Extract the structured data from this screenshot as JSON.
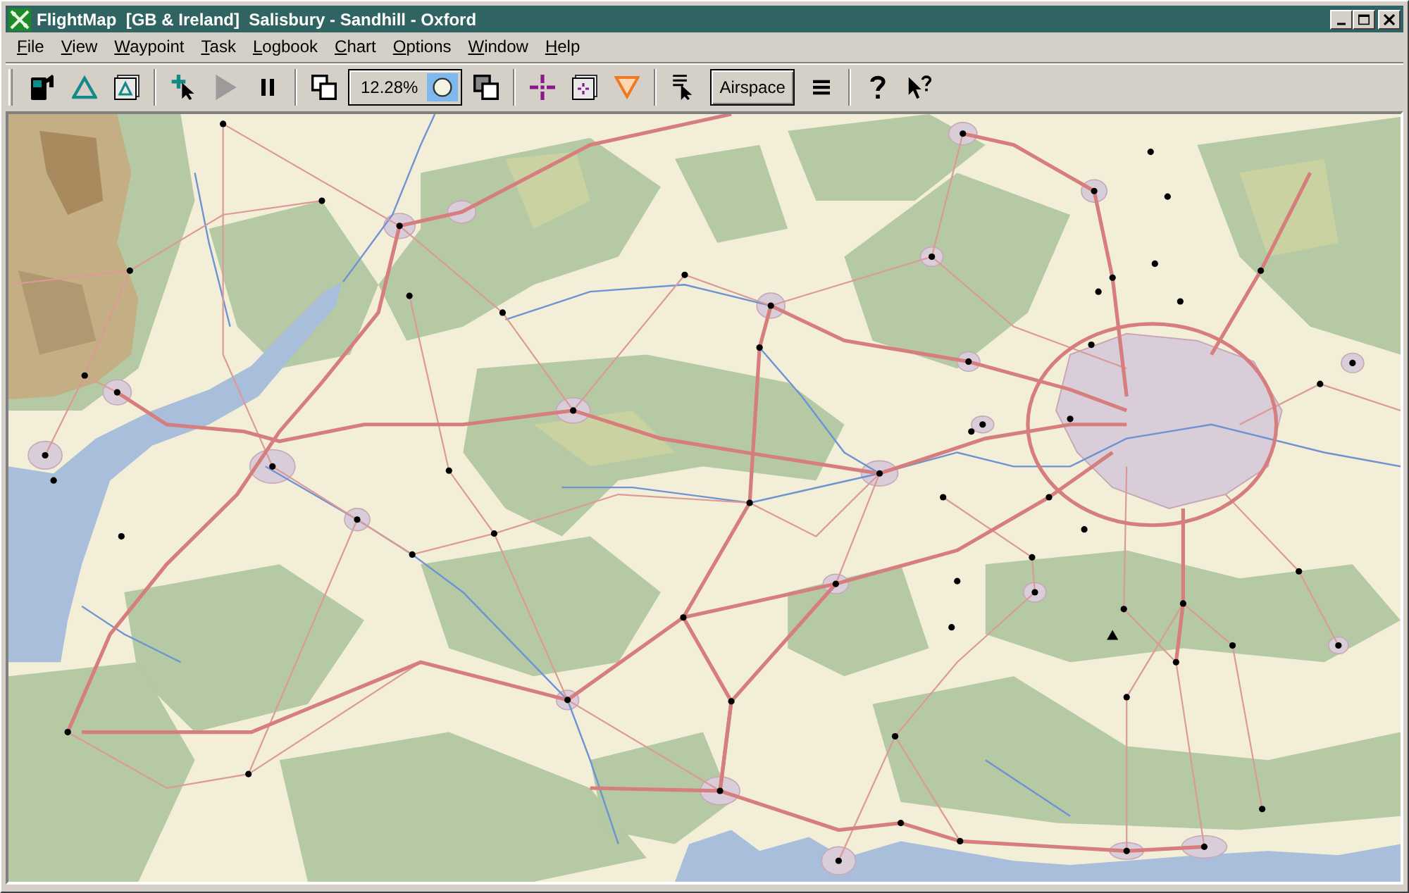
{
  "window": {
    "title": "FlightMap  [GB & Ireland]  Salisbury - Sandhill - Oxford"
  },
  "menu": [
    "File",
    "View",
    "Waypoint",
    "Task",
    "Logbook",
    "Chart",
    "Options",
    "Window",
    "Help"
  ],
  "toolbar": {
    "groups": [
      [
        {
          "kind": "icon",
          "disabled": false
        },
        {
          "kind": "icon",
          "disabled": false
        },
        {
          "kind": "icon",
          "disabled": false
        }
      ],
      [
        {
          "kind": "icon",
          "disabled": false
        },
        {
          "kind": "icon",
          "disabled": true
        },
        {
          "kind": "icon",
          "disabled": false
        }
      ],
      [
        {
          "kind": "icon",
          "disabled": false
        },
        {
          "kind": "zoom",
          "value": "12.28%",
          "pressed": true
        },
        {
          "kind": "icon",
          "disabled": false
        }
      ],
      [
        {
          "kind": "icon",
          "disabled": false
        },
        {
          "kind": "icon",
          "disabled": false
        },
        {
          "kind": "icon",
          "disabled": false
        }
      ],
      [
        {
          "kind": "icon",
          "disabled": false
        },
        {
          "kind": "text",
          "label": "Airspace"
        },
        {
          "kind": "icon",
          "disabled": false
        }
      ],
      [
        {
          "kind": "icon",
          "disabled": false
        },
        {
          "kind": "icon",
          "disabled": false
        }
      ]
    ]
  }
}
